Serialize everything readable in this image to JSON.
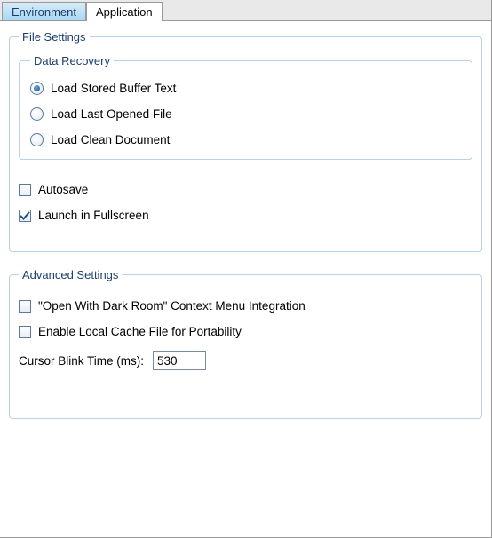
{
  "tabs": {
    "environment": "Environment",
    "application": "Application"
  },
  "fileSettings": {
    "legend": "File Settings",
    "dataRecovery": {
      "legend": "Data Recovery",
      "options": {
        "loadBuffer": "Load Stored Buffer Text",
        "loadLast": "Load Last Opened File",
        "loadClean": "Load Clean Document"
      },
      "selected": "loadBuffer"
    },
    "autosave": {
      "label": "Autosave",
      "checked": false
    },
    "fullscreen": {
      "label": "Launch in Fullscreen",
      "checked": true
    }
  },
  "advanced": {
    "legend": "Advanced Settings",
    "contextMenu": {
      "label": "\"Open With Dark Room\" Context Menu Integration",
      "checked": false
    },
    "localCache": {
      "label": "Enable Local Cache File for Portability",
      "checked": false
    },
    "cursorBlink": {
      "label": "Cursor Blink Time (ms):",
      "value": "530"
    }
  }
}
